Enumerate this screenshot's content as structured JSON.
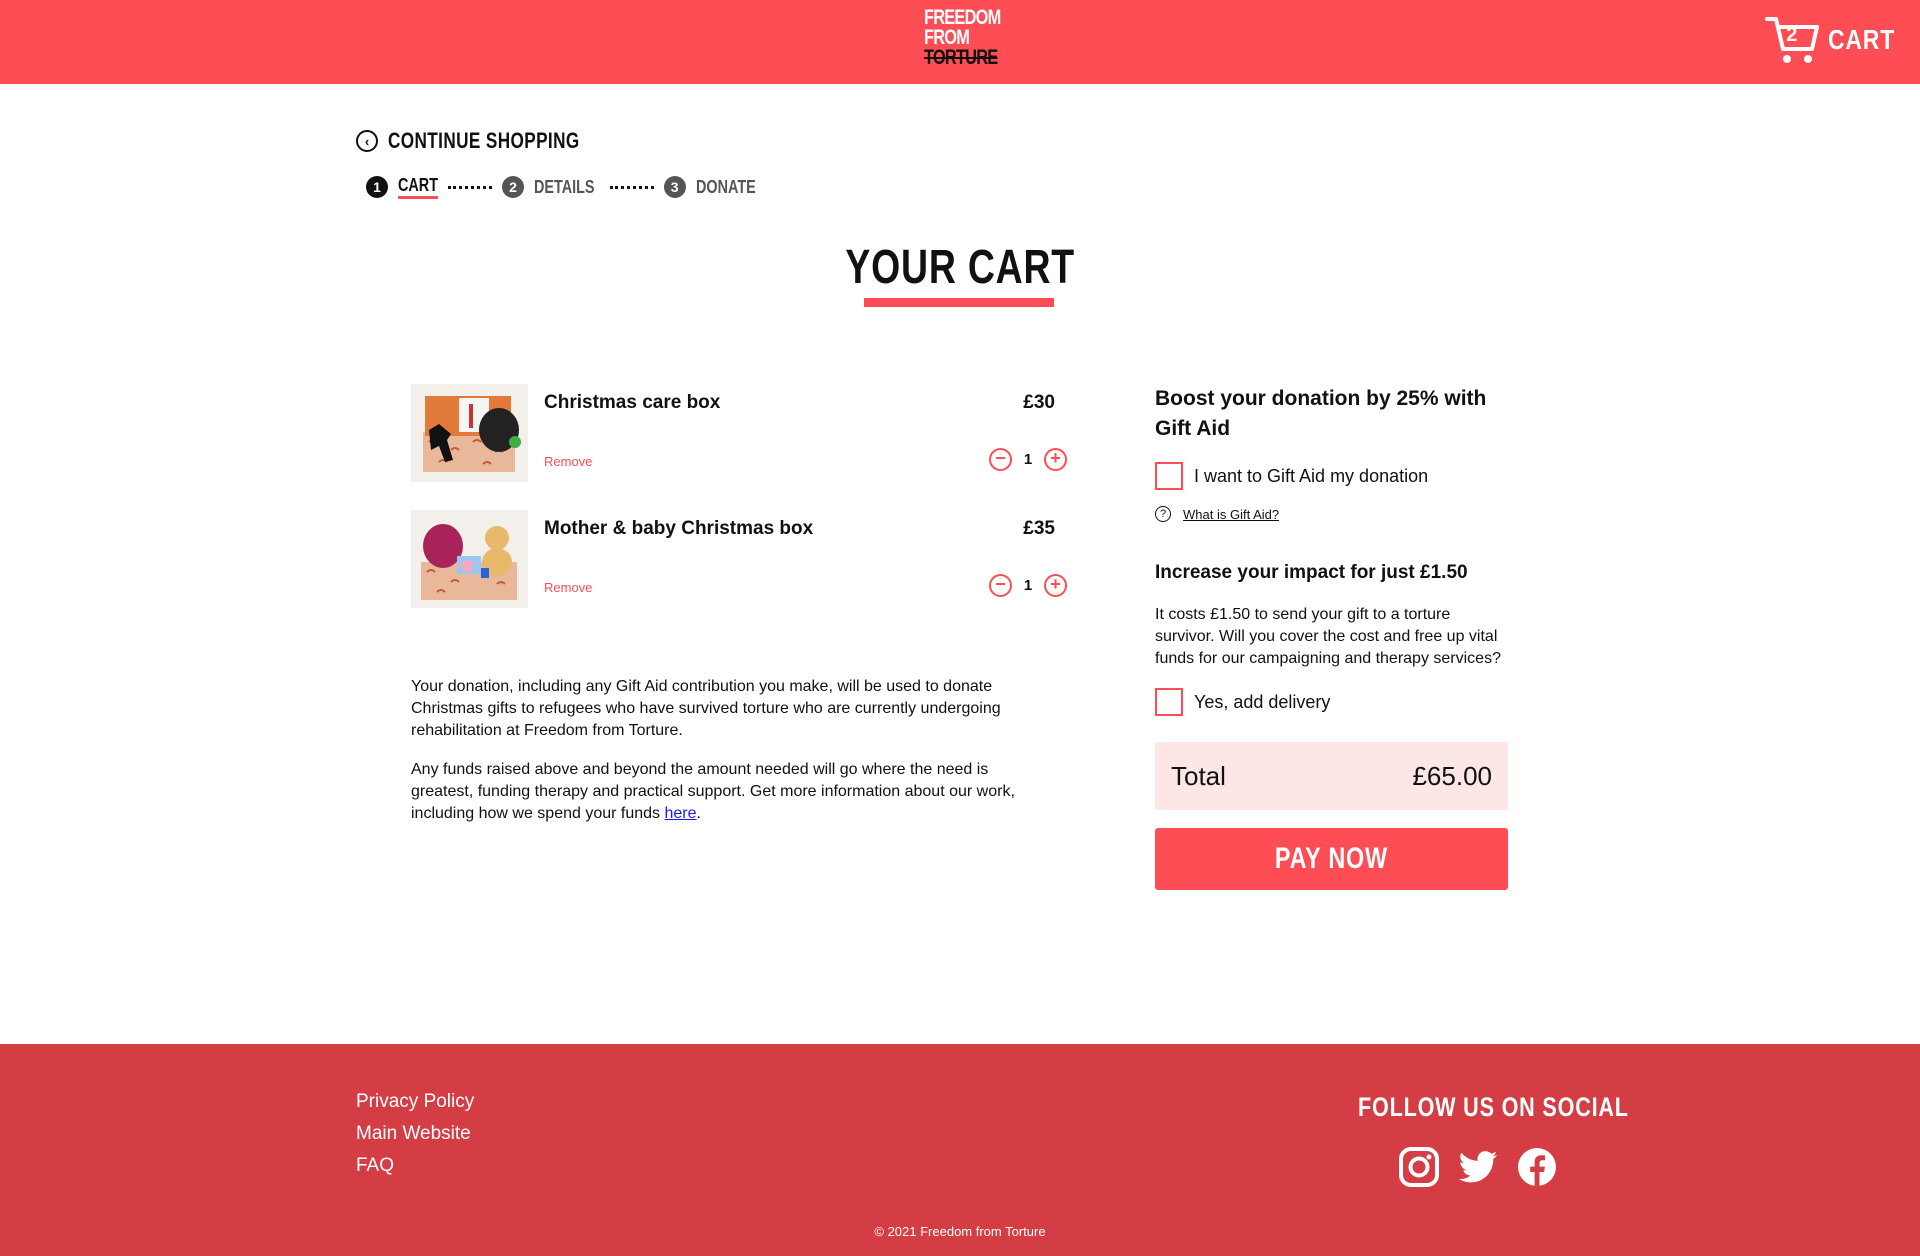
{
  "header": {
    "logo_lines": [
      "FREEDOM",
      "FROM",
      "TORTURE"
    ],
    "cart_count": "2",
    "cart_label": "CART"
  },
  "nav": {
    "continue_label": "CONTINUE SHOPPING",
    "steps": [
      {
        "number": "1",
        "label": "CART"
      },
      {
        "number": "2",
        "label": "DETAILS"
      },
      {
        "number": "3",
        "label": "DONATE"
      }
    ]
  },
  "page": {
    "title": "YOUR CART"
  },
  "cart": {
    "items": [
      {
        "name": "Christmas care box",
        "price": "£30",
        "remove_label": "Remove",
        "quantity": "1"
      },
      {
        "name": "Mother & baby Christmas box",
        "price": "£35",
        "remove_label": "Remove",
        "quantity": "1"
      }
    ],
    "info": {
      "p1": "Your donation, including any Gift Aid contribution you make, will be used to donate Christmas gifts to refugees who have survived torture who are currently undergoing rehabilitation at Freedom from Torture.",
      "p2_before": "Any funds raised above and beyond the amount needed will go where the need is greatest, funding therapy and practical support. Get more information about our work, including how we spend your funds ",
      "p2_link": "here",
      "p2_after": "."
    }
  },
  "side": {
    "gift_aid_title": "Boost your donation by 25% with Gift Aid",
    "gift_aid_checkbox": "I want to Gift Aid my donation",
    "gift_aid_help": "What is Gift Aid?",
    "impact_title": "Increase your impact for just £1.50",
    "impact_text": "It costs £1.50 to send your gift to a torture survivor. Will you cover the cost and free up vital funds for our campaigning and therapy services?",
    "delivery_checkbox": "Yes, add delivery",
    "total_label": "Total",
    "total_value": "£65.00",
    "pay_label": "PAY NOW"
  },
  "footer": {
    "links": [
      "Privacy Policy",
      "Main Website",
      "FAQ"
    ],
    "follow_title": "FOLLOW US ON SOCIAL",
    "social_icons": [
      "instagram-icon",
      "twitter-icon",
      "facebook-icon"
    ],
    "copyright": "© 2021 Freedom from Torture"
  },
  "colors": {
    "brand_red": "#fe4d55",
    "footer_red": "#d53d44",
    "total_bg": "#fde6e6"
  }
}
